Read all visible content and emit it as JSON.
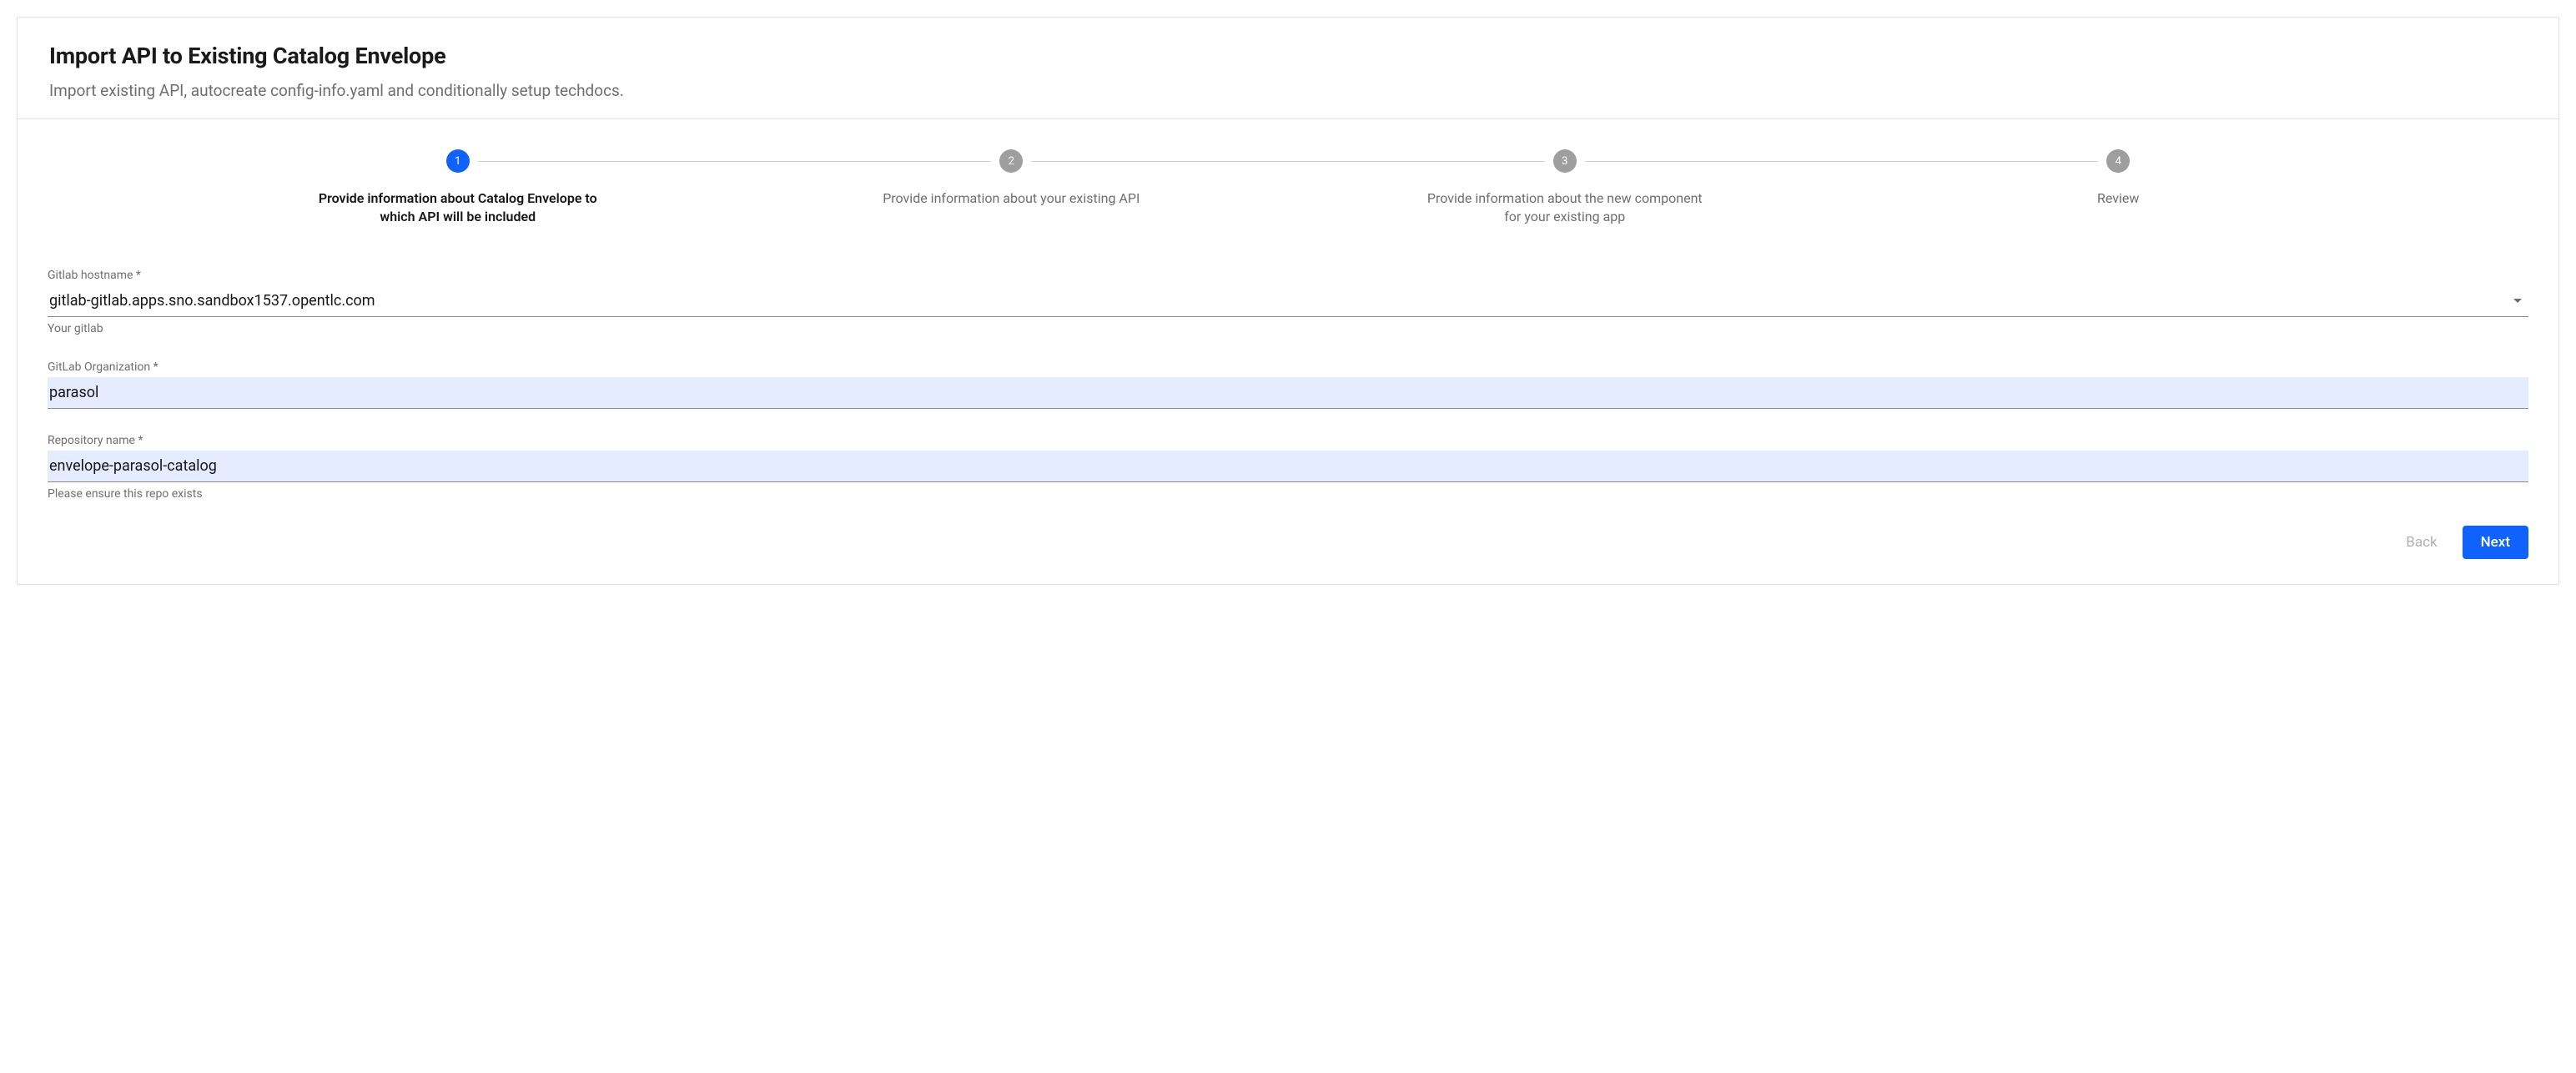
{
  "header": {
    "title": "Import API to Existing Catalog Envelope",
    "subtitle": "Import existing API, autocreate config-info.yaml and conditionally setup techdocs."
  },
  "stepper": {
    "steps": [
      {
        "num": "1",
        "label": "Provide information about Catalog Envelope to which API will be included",
        "active": true
      },
      {
        "num": "2",
        "label": "Provide information about your existing API",
        "active": false
      },
      {
        "num": "3",
        "label": "Provide information about the new component for your existing app",
        "active": false
      },
      {
        "num": "4",
        "label": "Review",
        "active": false
      }
    ]
  },
  "form": {
    "gitlab_host": {
      "label": "Gitlab hostname *",
      "value": "gitlab-gitlab.apps.sno.sandbox1537.opentlc.com",
      "help": "Your gitlab"
    },
    "gitlab_org": {
      "label": "GitLab Organization *",
      "value": "parasol"
    },
    "repo_name": {
      "label": "Repository name *",
      "value": "envelope-parasol-catalog",
      "help": "Please ensure this repo exists"
    }
  },
  "actions": {
    "back": "Back",
    "next": "Next"
  }
}
